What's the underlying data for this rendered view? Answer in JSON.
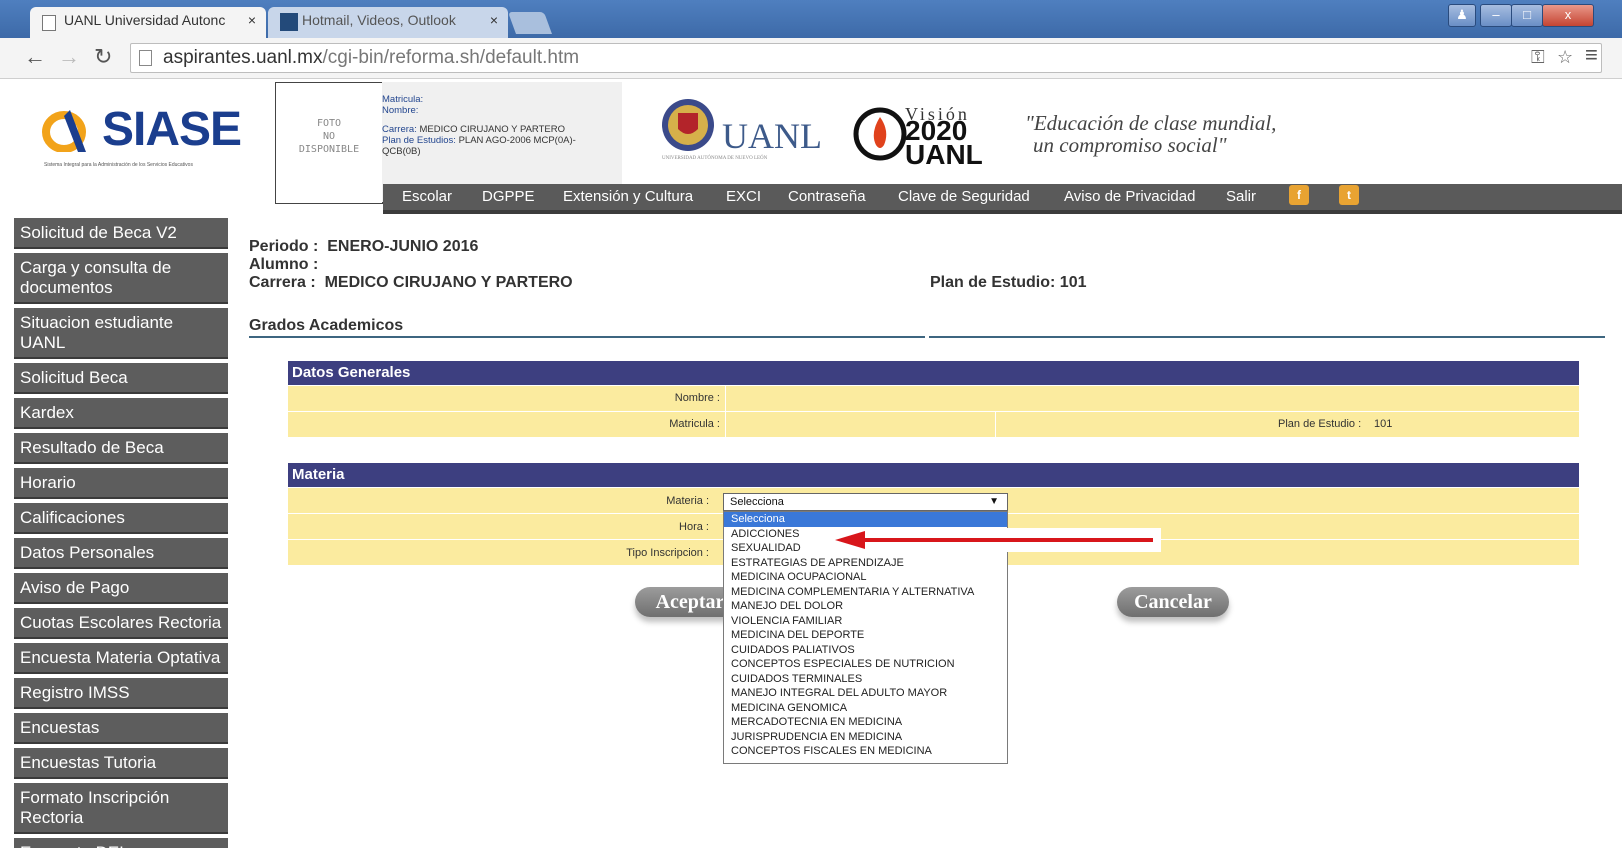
{
  "browser": {
    "tabs": [
      {
        "title": "UANL Universidad Autonc",
        "close": "×"
      },
      {
        "title": "Hotmail, Videos, Outlook",
        "close": "×"
      }
    ],
    "window_buttons": {
      "minimize": "–",
      "maximize": "□",
      "close": "x"
    },
    "url_host": "aspirantes.uanl.mx",
    "url_path": "/cgi-bin/reforma.sh/default.htm"
  },
  "header": {
    "logo_text": "SIASE",
    "logo_sub": "Sistema Integral para la Administración de los Servicios Educativos",
    "photo_placeholder": [
      "FOTO",
      "NO",
      "DISPONIBLE"
    ],
    "student_info": {
      "matricula_label": "Matricula:",
      "nombre_label": "Nombre:",
      "carrera_label": "Carrera:",
      "carrera_value": "MEDICO CIRUJANO Y PARTERO",
      "plan_label": "Plan de Estudios:",
      "plan_value": "PLAN AGO-2006 MCP(0A)-",
      "plan_value2": "QCB(0B)"
    },
    "uanl_text": "UANL",
    "uanl_sub": "UNIVERSIDAD AUTÓNOMA DE NUEVO LEÓN",
    "vision_title": "Visión",
    "vision_year": "2020",
    "vision_org": "UANL",
    "motto_line1": "\"Educación de clase mundial,",
    "motto_line2": "un compromiso social\""
  },
  "topnav": {
    "items": [
      "Escolar",
      "DGPPE",
      "Extensión y Cultura",
      "EXCI",
      "Contraseña",
      "Clave de Seguridad",
      "Aviso de Privacidad",
      "Salir"
    ]
  },
  "sidebar": {
    "items": [
      "Solicitud de Beca V2",
      "Carga y consulta de documentos",
      "Situacion estudiante UANL",
      "Solicitud Beca",
      "Kardex",
      "Resultado de Beca",
      "Horario",
      "Calificaciones",
      "Datos Personales",
      "Aviso de Pago",
      "Cuotas Escolares Rectoria",
      "Encuesta Materia Optativa",
      "Registro IMSS",
      "Encuestas",
      "Encuestas Tutoria",
      "Formato Inscripción Rectoria",
      "Encuesta DEL"
    ]
  },
  "main": {
    "periodo_label": "Periodo :",
    "periodo_value": "ENERO-JUNIO 2016",
    "alumno_label": "Alumno :",
    "carrera_label": "Carrera :",
    "carrera_value": "MEDICO CIRUJANO Y PARTERO",
    "plan_label": "Plan de Estudio:",
    "plan_value": "101",
    "section_title": "Grados Academicos",
    "datos_generales": {
      "title": "Datos Generales",
      "nombre_label": "Nombre :",
      "matricula_label": "Matricula :",
      "plan_label": "Plan de Estudio :",
      "plan_value": "101"
    },
    "materia": {
      "title": "Materia",
      "materia_label": "Materia :",
      "hora_label": "Hora :",
      "tipo_label": "Tipo Inscripcion :",
      "selected": "Selecciona",
      "options": [
        "Selecciona",
        "ADICCIONES",
        "SEXUALIDAD",
        "ESTRATEGIAS DE APRENDIZAJE",
        "MEDICINA OCUPACIONAL",
        "MEDICINA COMPLEMENTARIA Y ALTERNATIVA",
        "MANEJO DEL DOLOR",
        "VIOLENCIA FAMILIAR",
        "MEDICINA DEL DEPORTE",
        "CUIDADOS PALIATIVOS",
        "CONCEPTOS ESPECIALES DE NUTRICION",
        "CUIDADOS TERMINALES",
        "MANEJO INTEGRAL DEL ADULTO MAYOR",
        "MEDICINA GENOMICA",
        "MERCADOTECNIA EN MEDICINA",
        "JURISPRUDENCIA EN MEDICINA",
        "CONCEPTOS FISCALES EN MEDICINA"
      ]
    },
    "aceptar_label": "Aceptar",
    "cancelar_label": "Cancelar"
  },
  "colors": {
    "panel_header": "#3d3f80",
    "panel_row": "#fbeb9f",
    "sidebar_bg": "#5d5d5d",
    "dropdown_selected": "#3a78d8",
    "annotation_arrow": "#d8161b"
  }
}
